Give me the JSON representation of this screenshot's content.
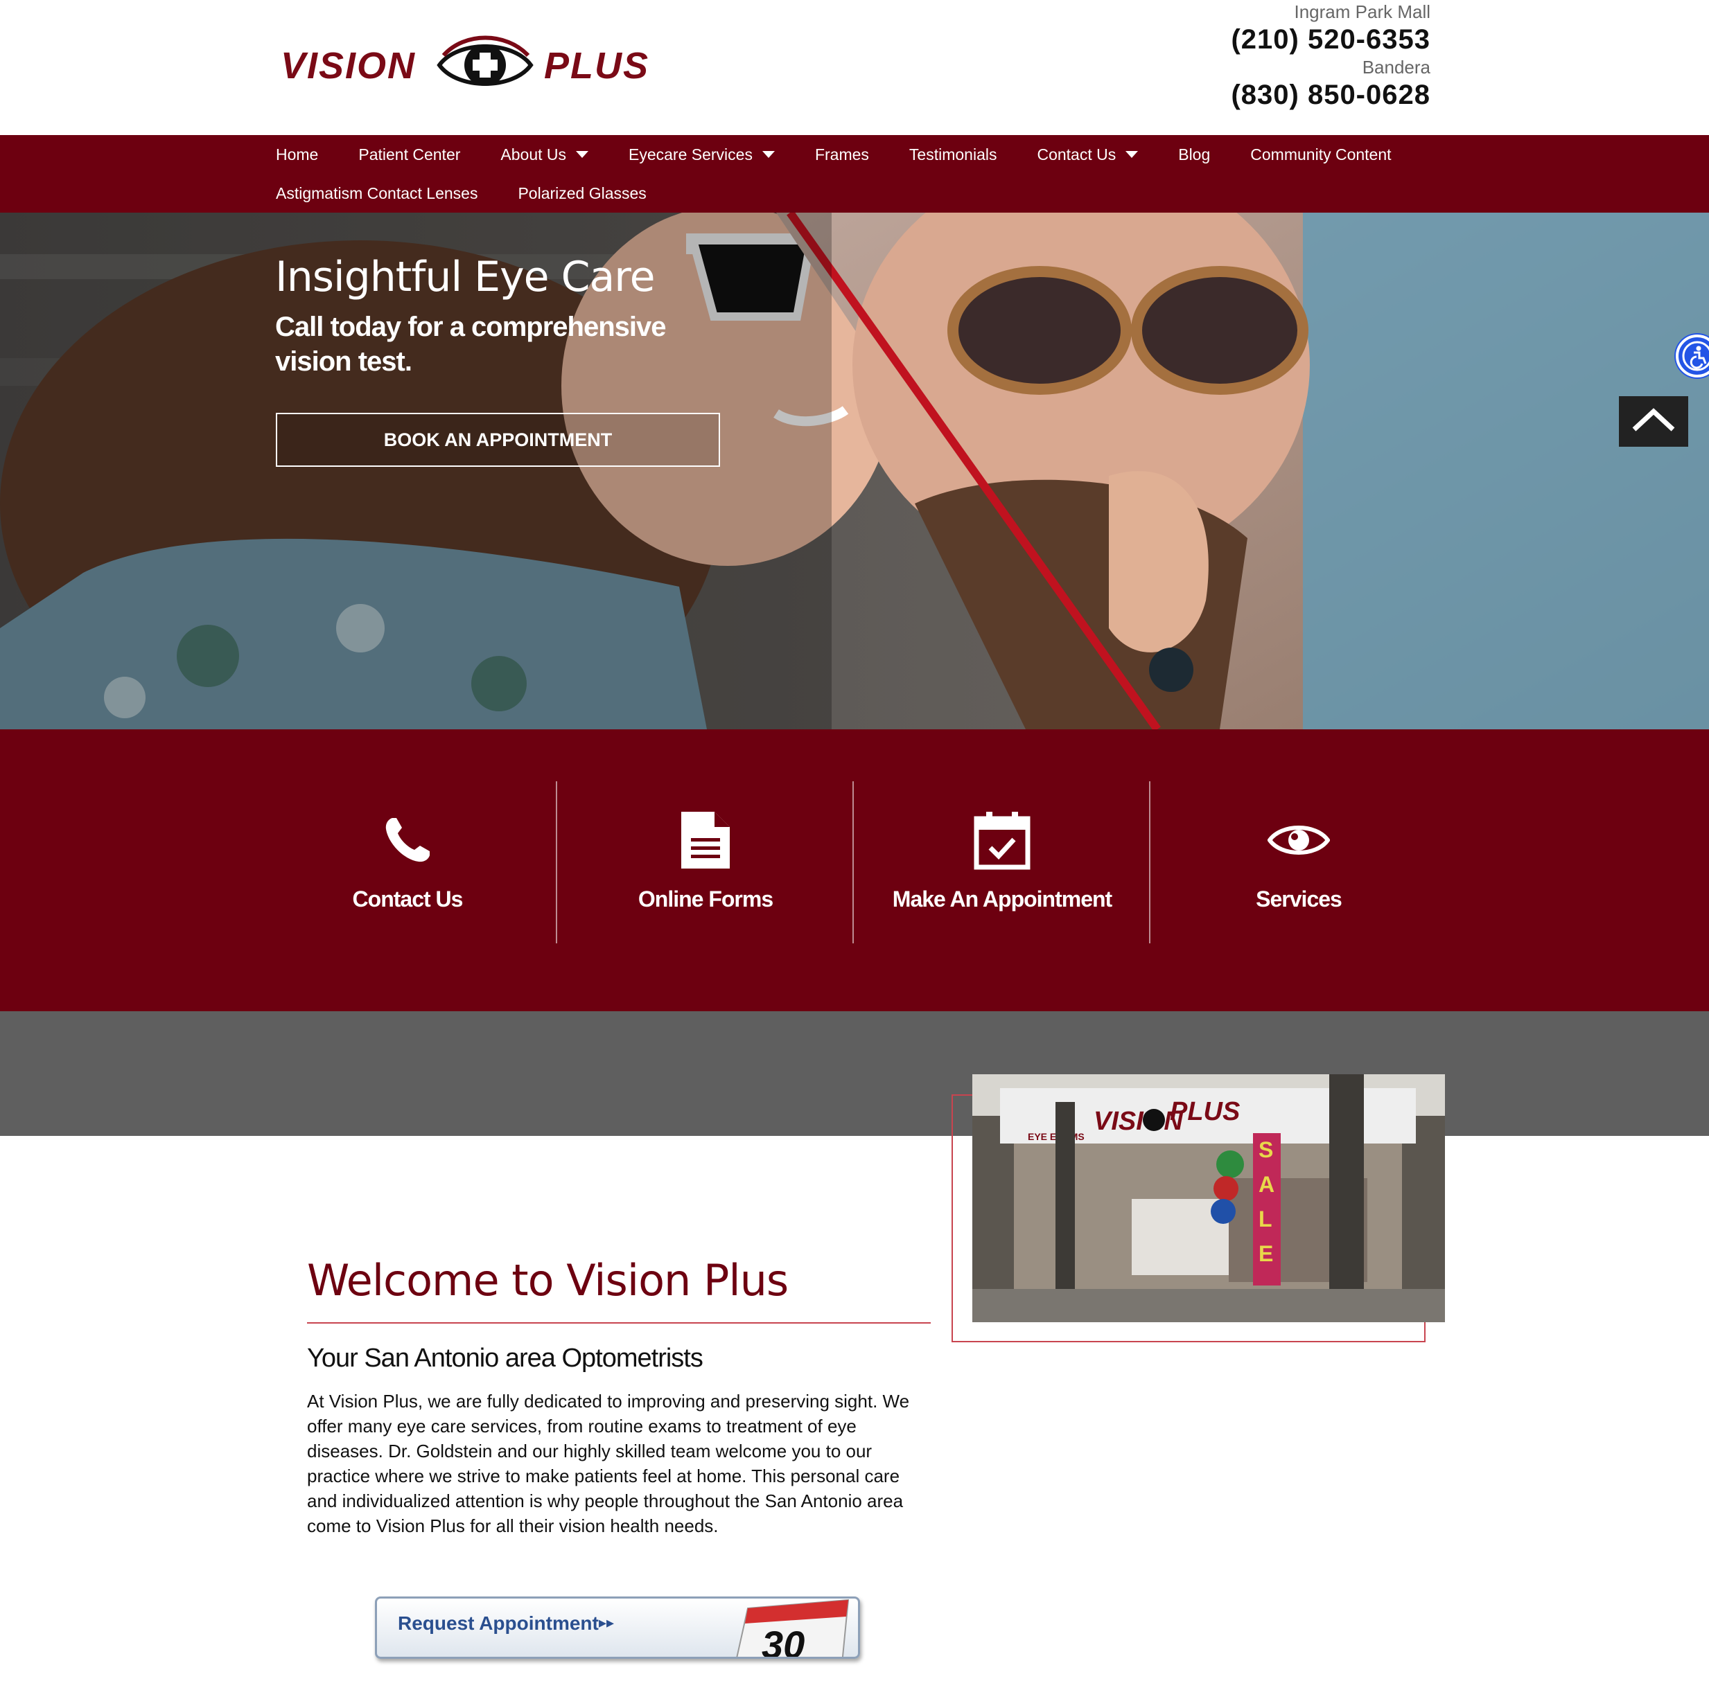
{
  "brand": {
    "logo_left": "VISION",
    "logo_right": "PLUS",
    "accent_color": "#6d0010"
  },
  "locations": [
    {
      "name": "Ingram Park Mall",
      "phone": "(210) 520-6353"
    },
    {
      "name": "Bandera",
      "phone": "(830) 850-0628"
    }
  ],
  "nav": {
    "row1": [
      {
        "label": "Home",
        "has_dropdown": false
      },
      {
        "label": "Patient Center",
        "has_dropdown": false
      },
      {
        "label": "About Us",
        "has_dropdown": true
      },
      {
        "label": "Eyecare Services",
        "has_dropdown": true
      },
      {
        "label": "Frames",
        "has_dropdown": false
      },
      {
        "label": "Testimonials",
        "has_dropdown": false
      },
      {
        "label": "Contact Us",
        "has_dropdown": true
      },
      {
        "label": "Blog",
        "has_dropdown": false
      },
      {
        "label": "Community Content",
        "has_dropdown": false
      }
    ],
    "row2": [
      {
        "label": "Astigmatism Contact Lenses",
        "has_dropdown": false
      },
      {
        "label": "Polarized Glasses",
        "has_dropdown": false
      }
    ]
  },
  "hero": {
    "title": "Insightful Eye Care",
    "subtitle": "Call today for a comprehensive vision test.",
    "button_label": "BOOK AN APPOINTMENT"
  },
  "features": [
    {
      "label": "Contact Us",
      "icon": "phone-icon"
    },
    {
      "label": "Online Forms",
      "icon": "document-icon"
    },
    {
      "label": "Make An Appointment",
      "icon": "calendar-check-icon"
    },
    {
      "label": "Services",
      "icon": "eye-icon"
    }
  ],
  "welcome": {
    "title": "Welcome to Vision Plus",
    "subtitle": "Your San Antonio area Optometrists",
    "body": "At Vision Plus, we are fully dedicated to improving and preserving sight. We offer many eye care services, from routine exams to treatment of eye diseases. Dr. Goldstein and our highly skilled team welcome you to our practice where we strive to make patients feel at home. This personal care and individualized attention is why people throughout the San Antonio area come to Vision Plus for all their vision health needs."
  },
  "store_photo": {
    "sign_left": "VISION",
    "sign_right": "PLUS",
    "banner": "SALE",
    "side_sign": "EYE EXAMS"
  },
  "request_widget": {
    "label": "Request Appointment",
    "arrows": "▸▸",
    "calendar_day": "30"
  }
}
